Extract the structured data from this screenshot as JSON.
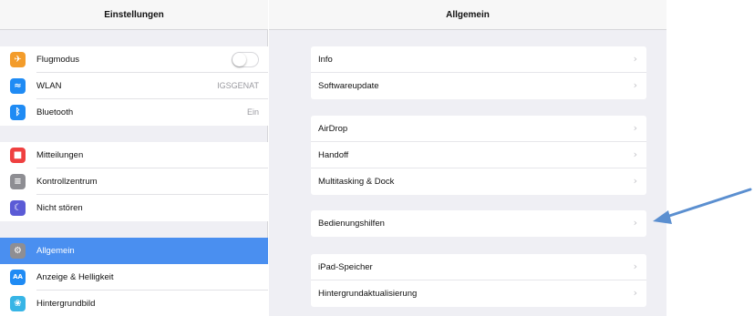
{
  "sidebar": {
    "title": "Einstellungen",
    "items": [
      {
        "label": "Flugmodus",
        "icon": "airplane-icon",
        "color": "#f39c2b",
        "glyph": "✈",
        "toggle": "off"
      },
      {
        "label": "WLAN",
        "icon": "wifi-icon",
        "color": "#1f8bf4",
        "glyph": "≈",
        "value": "IGSGENAT"
      },
      {
        "label": "Bluetooth",
        "icon": "bluetooth-icon",
        "color": "#1f8bf4",
        "glyph": "ᛒ",
        "value": "Ein"
      },
      {
        "label": "Mitteilungen",
        "icon": "notifications-icon",
        "color": "#ef4040",
        "glyph": "■"
      },
      {
        "label": "Kontrollzentrum",
        "icon": "control-center-icon",
        "color": "#8e8e93",
        "glyph": "≡"
      },
      {
        "label": "Nicht stören",
        "icon": "moon-icon",
        "color": "#5b5bd6",
        "glyph": "☾"
      },
      {
        "label": "Allgemein",
        "icon": "gear-icon",
        "color": "#8e8e93",
        "glyph": "⚙",
        "selected": true
      },
      {
        "label": "Anzeige & Helligkeit",
        "icon": "display-icon",
        "color": "#1f8bf4",
        "glyph": "AA"
      },
      {
        "label": "Hintergrundbild",
        "icon": "wallpaper-icon",
        "color": "#37b5e6",
        "glyph": "❀"
      }
    ]
  },
  "detail": {
    "title": "Allgemein",
    "groups": [
      [
        "Info",
        "Softwareupdate"
      ],
      [
        "AirDrop",
        "Handoff",
        "Multitasking & Dock"
      ],
      [
        "Bedienungshilfen"
      ],
      [
        "iPad-Speicher",
        "Hintergrundaktualisierung"
      ]
    ]
  },
  "colors": {
    "accent": "#4a8ff0",
    "annotation_arrow": "#5b8fd0"
  }
}
